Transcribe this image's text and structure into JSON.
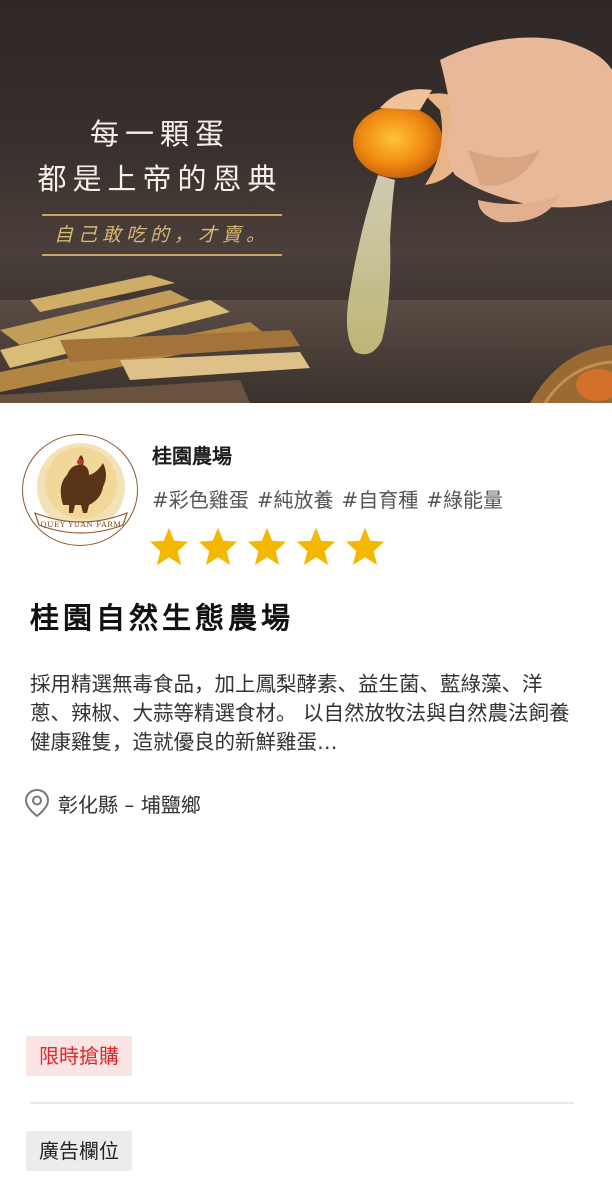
{
  "hero": {
    "tagline_line1": "每一顆蛋",
    "tagline_line2": "都是上帝的恩典",
    "signature": "自己敢吃的，才賣。"
  },
  "farm": {
    "logo_text": "QUEY YUAN FARM",
    "short_name": "桂園農場",
    "tags": [
      "#彩色雞蛋",
      "#純放養",
      "#自育種",
      "#綠能量"
    ],
    "rating": 5,
    "star_color": "#f5b800",
    "title": "桂園自然生態農場",
    "description": "採用精選無毒食品，加上鳳梨酵素、益生菌、藍綠藻、洋蔥、辣椒、大蒜等精選食材。 以自然放牧法與自然農法飼養健康雞隻，造就優良的新鮮雞蛋…",
    "location": "彰化縣 – 埔鹽鄉",
    "location_icon": "map-pin-icon"
  },
  "badges": {
    "sale_label": "限時搶購",
    "sale_color": "#e0262a",
    "ad_label": "廣告欄位"
  }
}
